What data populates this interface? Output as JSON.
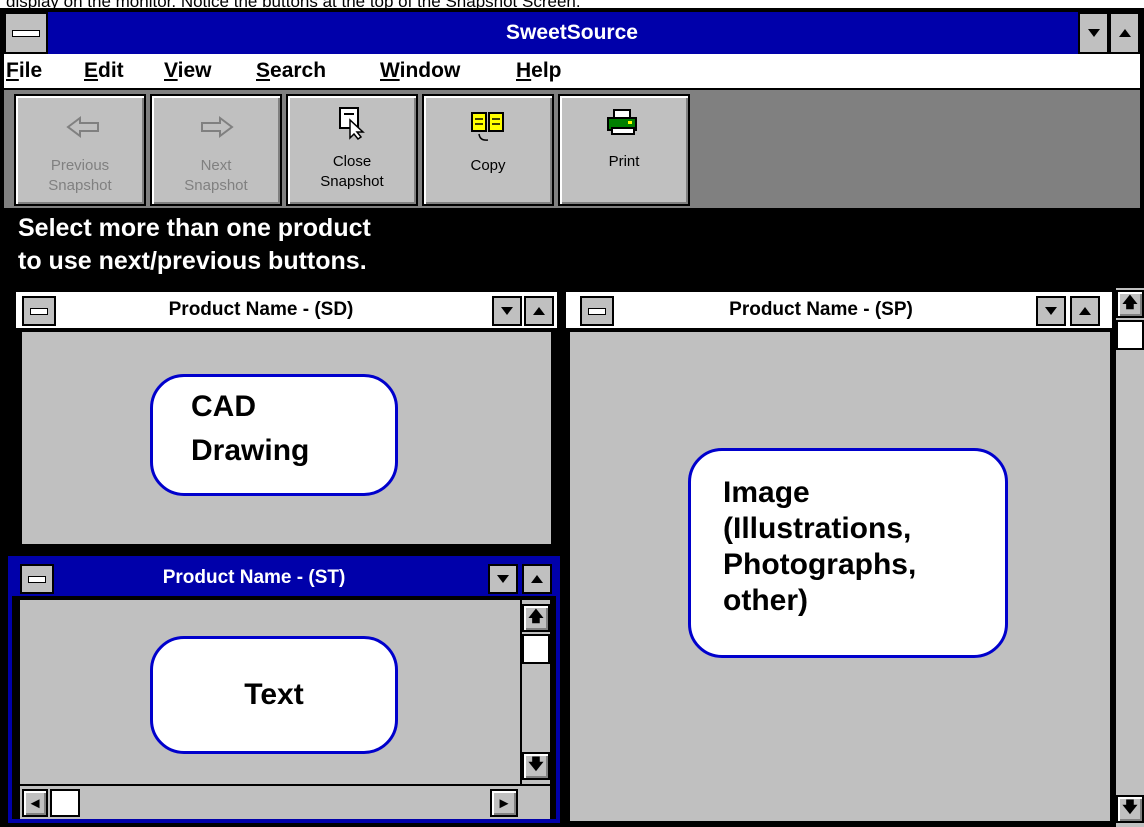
{
  "caption": "display on the monitor. Notice the buttons at the top of the Snapshot Screen.",
  "window": {
    "title": "SweetSource"
  },
  "menu": [
    {
      "mnemonic": "F",
      "rest": "ile"
    },
    {
      "mnemonic": "E",
      "rest": "dit"
    },
    {
      "mnemonic": "V",
      "rest": "iew"
    },
    {
      "mnemonic": "S",
      "rest": "earch"
    },
    {
      "mnemonic": "W",
      "rest": "indow"
    },
    {
      "mnemonic": "H",
      "rest": "elp"
    }
  ],
  "toolbar": {
    "prev": {
      "line1": "Previous",
      "line2": "Snapshot",
      "enabled": false
    },
    "next": {
      "line1": "Next",
      "line2": "Snapshot",
      "enabled": false
    },
    "close": {
      "line1": "Close",
      "line2": "Snapshot",
      "enabled": true
    },
    "copy": {
      "label": "Copy",
      "enabled": true
    },
    "print": {
      "label": "Print",
      "enabled": true
    }
  },
  "message": {
    "line1": "Select more than one product",
    "line2": "to use next/previous buttons."
  },
  "windows": {
    "sd": {
      "title": "Product Name - (SD)",
      "line1": "CAD",
      "line2": "Drawing"
    },
    "st": {
      "title": "Product Name - (ST)",
      "content": "Text"
    },
    "sp": {
      "title": "Product Name - (SP)",
      "lines": [
        "Image",
        "(Illustrations,",
        "Photographs,",
        "other)"
      ]
    }
  },
  "arrows": {
    "up": "▲",
    "down": "▼",
    "left": "◄",
    "right": "►",
    "scroll_up": "🡅",
    "scroll_down": "🡇"
  },
  "colors": {
    "titlebar": "#0000aa",
    "bubble_border": "#0000cc",
    "face": "#c0c0c0",
    "toolbar_bg": "#808080"
  }
}
